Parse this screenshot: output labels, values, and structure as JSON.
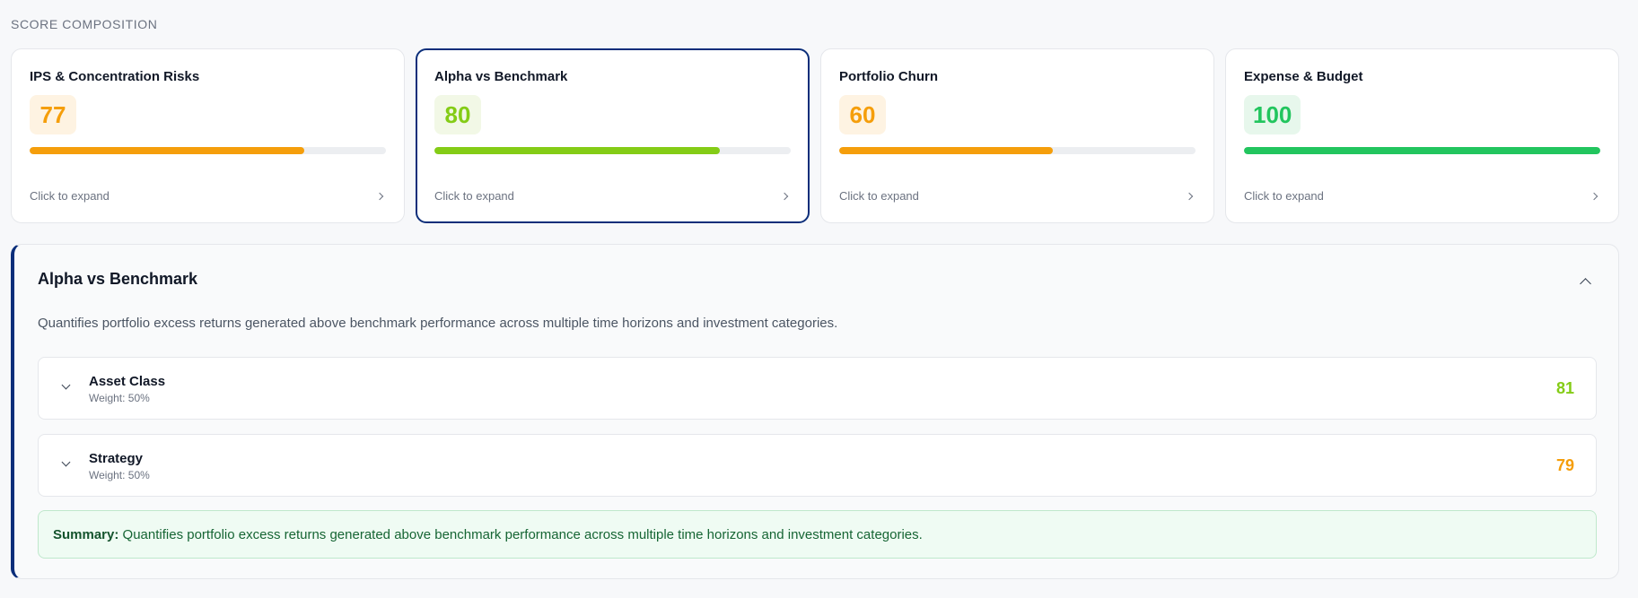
{
  "section_label": "SCORE COMPOSITION",
  "colors": {
    "orange": "#f59e0b",
    "lime": "#84cc16",
    "green": "#22c55e",
    "navy": "#0b2e7a"
  },
  "cards": [
    {
      "title": "IPS & Concentration Risks",
      "score": "77",
      "progress": 0.77,
      "color": "#f59e0b",
      "badge_bg": "#fef3e2",
      "footer": "Click to expand",
      "icon": "chevron-right-icon"
    },
    {
      "title": "Alpha vs Benchmark",
      "score": "80",
      "progress": 0.8,
      "color": "#84cc16",
      "badge_bg": "#f2f8e6",
      "footer": "Click to expand",
      "icon": "chevron-right-icon"
    },
    {
      "title": "Portfolio Churn",
      "score": "60",
      "progress": 0.6,
      "color": "#f59e0b",
      "badge_bg": "#fef3e2",
      "footer": "Click to expand",
      "icon": "chevron-right-icon"
    },
    {
      "title": "Expense & Budget",
      "score": "100",
      "progress": 1.0,
      "color": "#22c55e",
      "badge_bg": "#e7f7ec",
      "footer": "Click to expand",
      "icon": "chevron-right-icon"
    }
  ],
  "detail": {
    "title": "Alpha vs Benchmark",
    "description": "Quantifies portfolio excess returns generated above benchmark performance across multiple time horizons and investment categories.",
    "collapse_icon": "chevron-up-icon",
    "sub_items": [
      {
        "name": "Asset Class",
        "weight": "Weight: 50%",
        "score": "81",
        "color": "#84cc16",
        "icon": "chevron-down-icon"
      },
      {
        "name": "Strategy",
        "weight": "Weight: 50%",
        "score": "79",
        "color": "#f59e0b",
        "icon": "chevron-down-icon"
      }
    ],
    "summary_label": "Summary:",
    "summary_text": " Quantifies portfolio excess returns generated above benchmark performance across multiple time horizons and investment categories."
  }
}
